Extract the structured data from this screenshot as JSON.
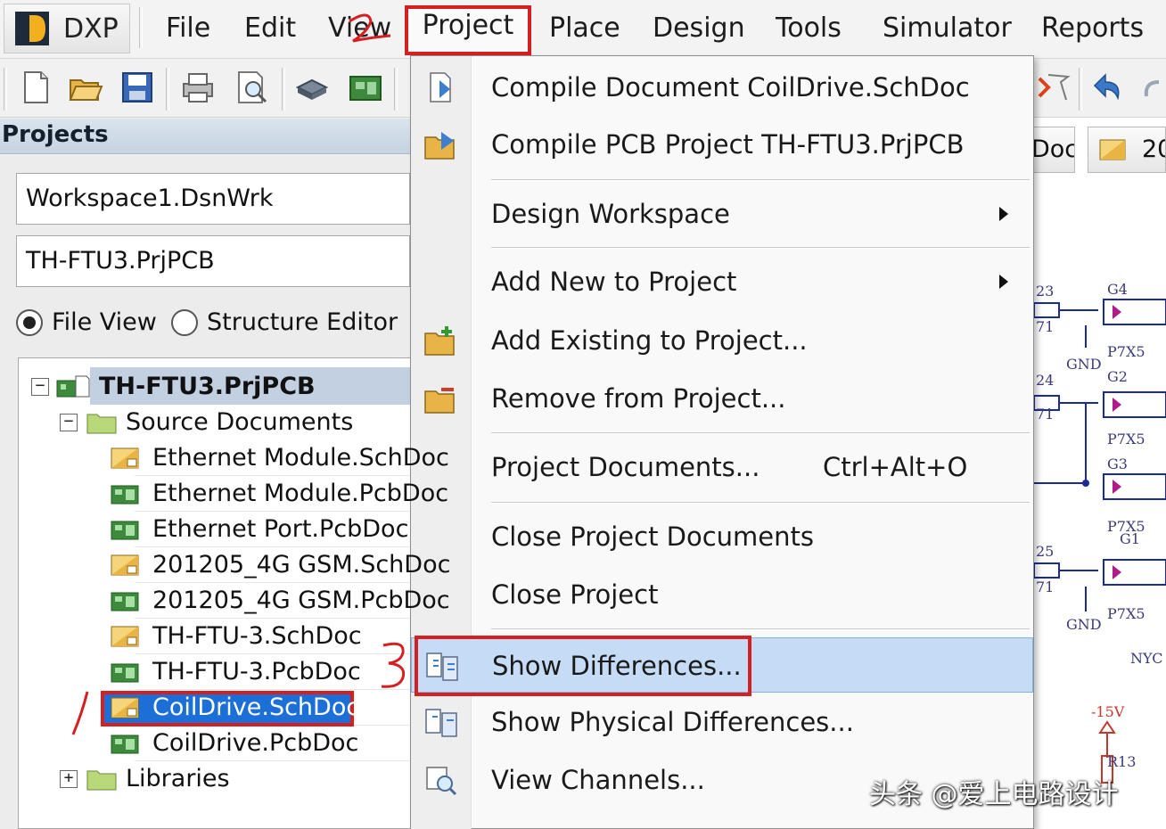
{
  "menubar": {
    "app_button": "DXP",
    "items": [
      "File",
      "Edit",
      "View",
      "Project",
      "Place",
      "Design",
      "Tools",
      "Simulator",
      "Reports"
    ]
  },
  "toolbar": {
    "icons": [
      "new-document-icon",
      "open-folder-icon",
      "save-icon",
      "print-icon",
      "print-preview-icon",
      "3d-view-icon",
      "pcb-icon",
      "cross-select-icon",
      "undo-icon",
      "redo-icon"
    ]
  },
  "projects_panel": {
    "title": "Projects",
    "workspace": "Workspace1.DsnWrk",
    "project": "TH-FTU3.PrjPCB",
    "view_options": [
      {
        "label": "File View",
        "selected": true
      },
      {
        "label": "Structure Editor",
        "selected": false
      }
    ],
    "tree": {
      "root": "TH-FTU3.PrjPCB",
      "source_folder": "Source Documents",
      "documents": [
        {
          "name": "Ethernet Module.SchDoc",
          "kind": "sch"
        },
        {
          "name": "Ethernet Module.PcbDoc",
          "kind": "pcb"
        },
        {
          "name": "Ethernet Port.PcbDoc",
          "kind": "pcb"
        },
        {
          "name": "201205_4G GSM.SchDoc",
          "kind": "sch"
        },
        {
          "name": "201205_4G GSM.PcbDoc",
          "kind": "pcb"
        },
        {
          "name": "TH-FTU-3.SchDoc",
          "kind": "sch"
        },
        {
          "name": "TH-FTU-3.PcbDoc",
          "kind": "pcb"
        },
        {
          "name": "CoilDrive.SchDoc",
          "kind": "sch",
          "selected": true
        },
        {
          "name": "CoilDrive.PcbDoc",
          "kind": "pcb"
        }
      ],
      "libraries_folder": "Libraries"
    }
  },
  "project_menu": {
    "items": [
      {
        "label": "Compile Document CoilDrive.SchDoc",
        "icon": "compile-document-icon"
      },
      {
        "label": "Compile PCB Project TH-FTU3.PrjPCB",
        "icon": "compile-project-icon"
      },
      {
        "label": "Design Workspace",
        "submenu": true
      },
      {
        "label": "Add New to Project",
        "submenu": true
      },
      {
        "label": "Add Existing to Project...",
        "icon": "add-existing-icon"
      },
      {
        "label": "Remove from Project...",
        "icon": "remove-from-project-icon"
      },
      {
        "label": "Project Documents...",
        "shortcut": "Ctrl+Alt+O"
      },
      {
        "label": "Close Project Documents"
      },
      {
        "label": "Close Project"
      },
      {
        "label": "Show Differences...",
        "icon": "show-differences-icon",
        "highlighted": true
      },
      {
        "label": "Show Physical Differences...",
        "icon": "show-physical-differences-icon"
      },
      {
        "label": "View Channels...",
        "icon": "view-channels-icon"
      }
    ]
  },
  "document_tabs": [
    "Doc",
    "20"
  ],
  "schematic_labels": [
    "G4",
    "P7X5",
    "GND",
    "G2",
    "P7X5",
    "G3",
    "P7X5",
    "G1",
    "P7X5",
    "GND",
    "NYC",
    "-15V",
    "R13",
    "23",
    "71",
    "24",
    "71",
    "25",
    "71"
  ],
  "annotations": [
    "1",
    "2",
    "3"
  ],
  "watermark": "头条 @爱上电路设计"
}
